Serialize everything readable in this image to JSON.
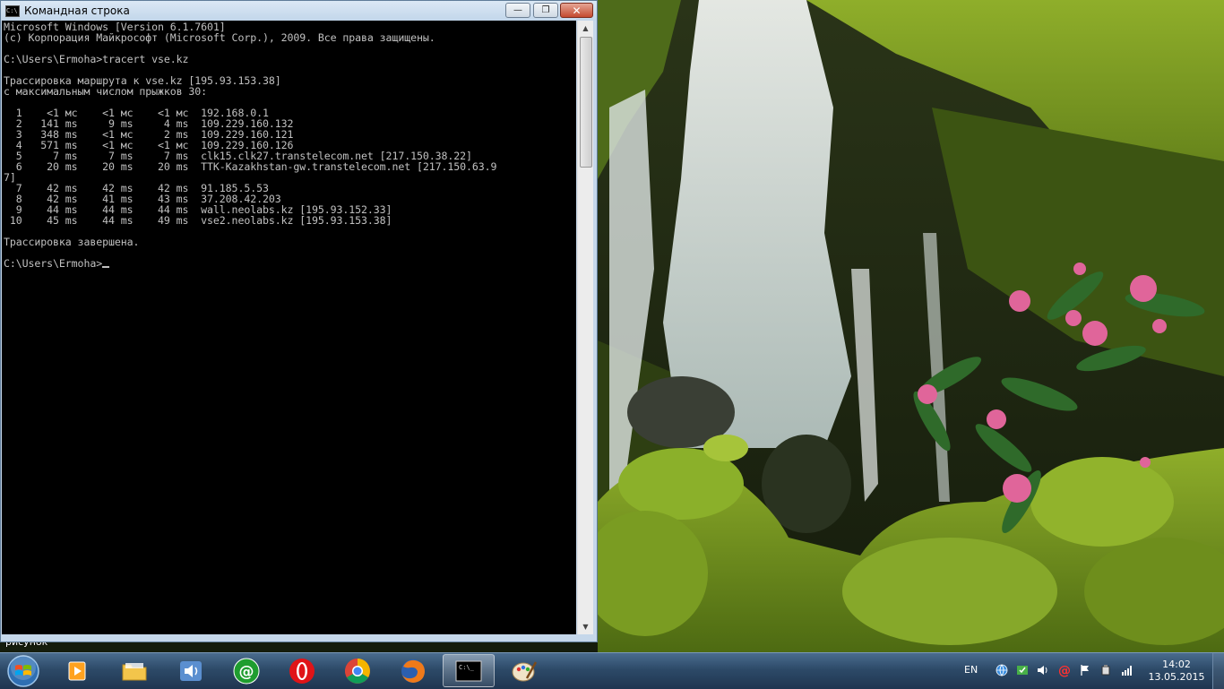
{
  "window": {
    "title": "Командная строка",
    "icon_text": "C:\\",
    "minimize_glyph": "—",
    "maximize_glyph": "❐",
    "close_glyph": "✕"
  },
  "console": {
    "lines": [
      "Microsoft Windows [Version 6.1.7601]",
      "(c) Корпорация Майкрософт (Microsoft Corp.), 2009. Все права защищены.",
      "",
      "C:\\Users\\Ermoha>tracert vse.kz",
      "",
      "Трассировка маршрута к vse.kz [195.93.153.38]",
      "с максимальным числом прыжков 30:",
      "",
      "  1    <1 мс    <1 мс    <1 мс  192.168.0.1",
      "  2   141 ms     9 ms     4 ms  109.229.160.132",
      "  3   348 ms    <1 мс     2 ms  109.229.160.121",
      "  4   571 ms    <1 мс    <1 мс  109.229.160.126",
      "  5     7 ms     7 ms     7 ms  clk15.clk27.transtelecom.net [217.150.38.22]",
      "  6    20 ms    20 ms    20 ms  TTK-Kazakhstan-gw.transtelecom.net [217.150.63.9",
      "7]",
      "  7    42 ms    42 ms    42 ms  91.185.5.53",
      "  8    42 ms    41 ms    43 ms  37.208.42.203",
      "  9    44 ms    44 ms    44 ms  wall.neolabs.kz [195.93.152.33]",
      " 10    45 ms    44 ms    49 ms  vse2.neolabs.kz [195.93.153.38]",
      "",
      "Трассировка завершена.",
      ""
    ],
    "prompt": "C:\\Users\\Ermoha>"
  },
  "desktop": {
    "icon_label": "рисунок"
  },
  "taskbar": {
    "pinned": [
      {
        "name": "media-player",
        "icon": "media-player-icon"
      },
      {
        "name": "explorer",
        "icon": "folder-icon"
      },
      {
        "name": "volume-app",
        "icon": "speaker-icon"
      },
      {
        "name": "mail-agent",
        "icon": "at-sign-icon"
      },
      {
        "name": "opera",
        "icon": "opera-icon"
      },
      {
        "name": "chrome",
        "icon": "chrome-icon"
      },
      {
        "name": "firefox",
        "icon": "firefox-icon"
      },
      {
        "name": "cmd",
        "icon": "console-icon",
        "active": true
      },
      {
        "name": "paint",
        "icon": "paint-icon"
      }
    ],
    "language": "EN",
    "time": "14:02",
    "date": "13.05.2015"
  },
  "colors": {
    "console_bg": "#000000",
    "console_fg": "#c0c0c0",
    "taskbar": "#2d4a68",
    "close_button": "#c44a30"
  }
}
